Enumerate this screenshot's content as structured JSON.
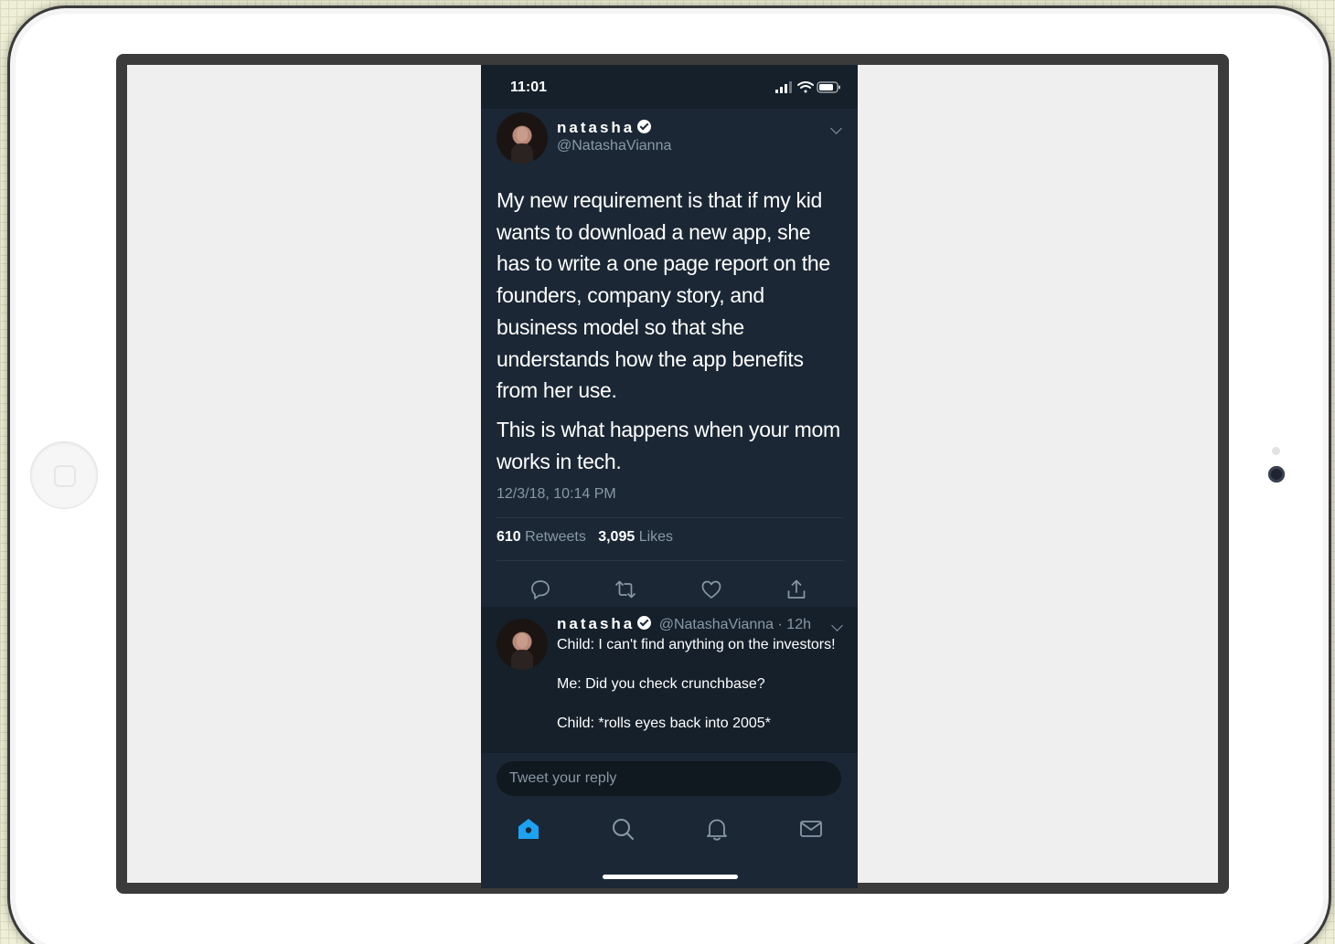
{
  "status_bar": {
    "time": "11:01"
  },
  "tweet": {
    "display_name": "natasha",
    "handle": "@NatashaVianna",
    "paragraphs": [
      "My new requirement is that if my kid wants to download a new app, she has to write a one page report on the founders, company story, and business model so that she understands how the app benefits from her use.",
      "This is what happens when your mom works in tech."
    ],
    "timestamp": "12/3/18, 10:14 PM",
    "retweets_count": "610",
    "retweets_label": "Retweets",
    "likes_count": "3,095",
    "likes_label": "Likes"
  },
  "reply": {
    "display_name": "natasha",
    "handle_time": "@NatashaVianna · 12h",
    "line1": "Child: I can't find anything on the investors!",
    "line2": "Me: Did you check crunchbase?",
    "line3": "Child: *rolls eyes back into 2005*"
  },
  "composer": {
    "placeholder": "Tweet your reply"
  },
  "colors": {
    "background": "#15202b",
    "card": "#1b2735",
    "secondary_text": "#8899a6",
    "accent": "#1da1f2"
  },
  "icons": {
    "status": [
      "signal-icon",
      "wifi-icon",
      "battery-icon"
    ],
    "actions": [
      "reply-icon",
      "retweet-icon",
      "like-icon",
      "share-icon"
    ],
    "tabs": [
      "home-icon",
      "search-icon",
      "notifications-icon",
      "messages-icon"
    ]
  }
}
